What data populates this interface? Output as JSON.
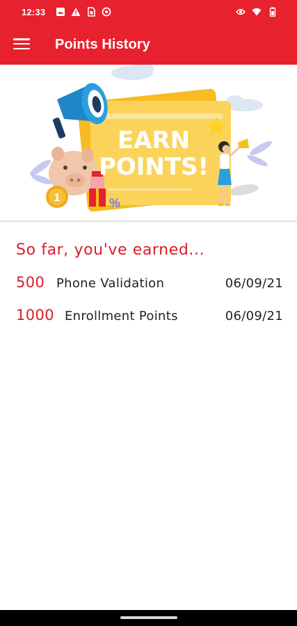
{
  "status_bar": {
    "time": "12:33",
    "left_icons": [
      "image-icon",
      "alert-icon",
      "sim-icon",
      "data-saver-icon"
    ],
    "right_icons": [
      "eye-icon",
      "wifi-icon",
      "battery-icon"
    ]
  },
  "app_bar": {
    "title": "Points History",
    "color": "#e8212e"
  },
  "banner": {
    "headline_line1": "EARN",
    "headline_line2": "POINTS!",
    "coin_label": "1",
    "percent_label": "%"
  },
  "history": {
    "heading": "So far, you've earned...",
    "items": [
      {
        "points": "500",
        "description": "Phone Validation",
        "date": "06/09/21"
      },
      {
        "points": "1000",
        "description": "Enrollment Points",
        "date": "06/09/21"
      }
    ]
  },
  "colors": {
    "accent": "#d81e27",
    "text": "#222222"
  }
}
